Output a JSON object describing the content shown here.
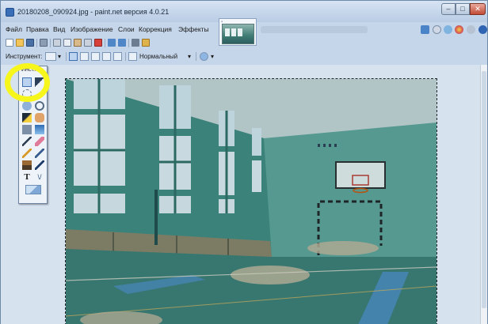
{
  "window": {
    "title": "20180208_090924.jpg - paint.net версия 4.0.21",
    "controls": {
      "minimize": "–",
      "maximize": "□",
      "close": "✕"
    }
  },
  "menu": {
    "file": "Файл",
    "edit": "Правка",
    "view": "Вид",
    "image": "Изображение",
    "layers": "Слои",
    "adjustments": "Коррекция",
    "effects": "Эффекты"
  },
  "toolbar2": {
    "tool_label": "Инструмент:",
    "blend_mode": "Нормальный"
  },
  "tools_window": {
    "title": "Инст..."
  },
  "colors": {
    "highlight_circle": "#f6f51c",
    "window_frame": "#c5d6ea",
    "close_button": "#c24b37"
  },
  "icons": {
    "toolbar": [
      "new-file-icon",
      "open-file-icon",
      "save-icon",
      "print-icon",
      "cut-icon",
      "copy-icon",
      "paste-icon",
      "crop-icon",
      "deselect-icon",
      "undo-icon",
      "redo-icon",
      "grid-icon",
      "ruler-icon"
    ],
    "tools": [
      "rectangle-select-icon",
      "move-selection-icon",
      "lasso-icon",
      "zoom-icon",
      "magic-wand-icon",
      "pan-icon",
      "paint-bucket-icon",
      "gradient-icon",
      "paintbrush-icon",
      "eraser-icon",
      "pencil-icon",
      "color-picker-icon",
      "clone-stamp-icon",
      "recolor-icon",
      "text-icon",
      "line-curve-icon",
      "shapes-icon"
    ]
  }
}
